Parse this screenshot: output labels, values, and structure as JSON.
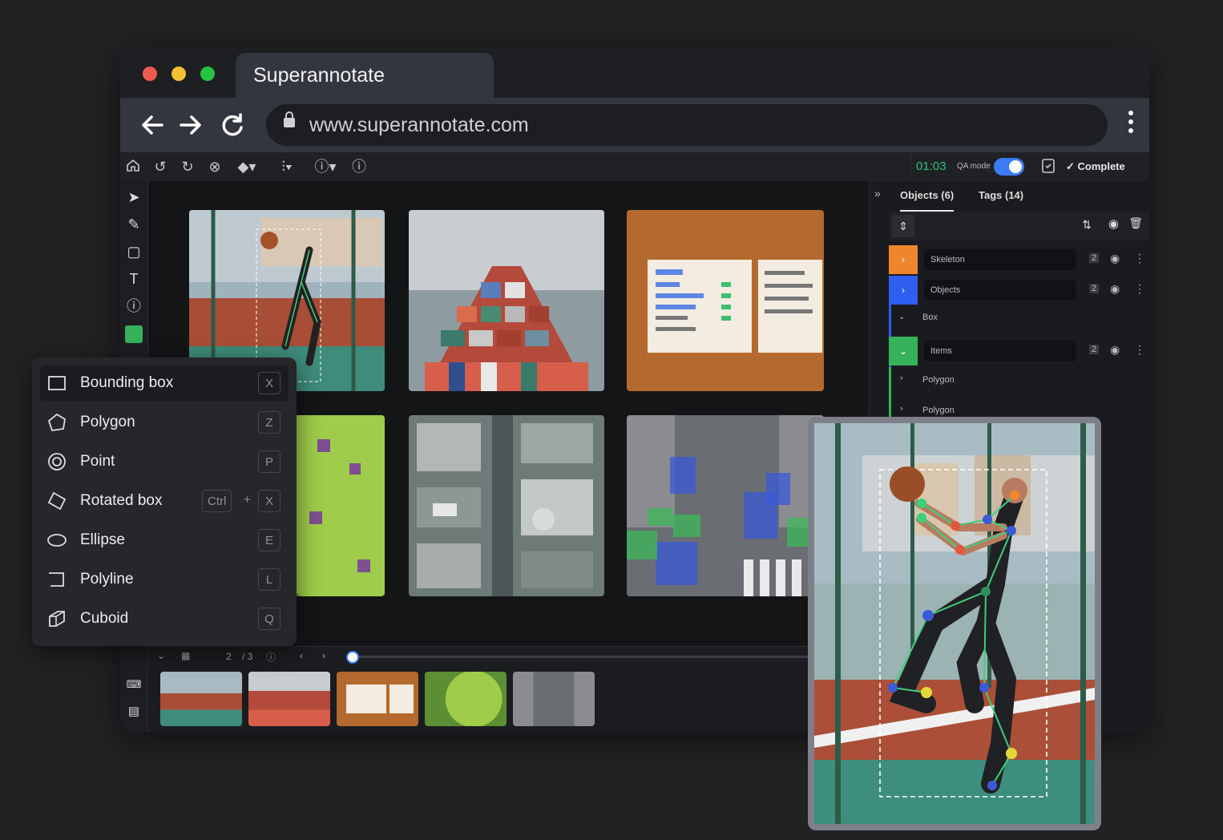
{
  "browser": {
    "tab_title": "Superannotate",
    "url": "www.superannotate.com",
    "traffic_colors": [
      "#ef5a4f",
      "#f4bf32",
      "#27c23f"
    ]
  },
  "toolbar": {
    "timer": "01:03",
    "qa_label": "QA mode",
    "complete_label": "Complete",
    "qa_enabled": true
  },
  "right_panel": {
    "tabs": [
      "Objects (6)",
      "Tags (14)"
    ],
    "groups": [
      {
        "name": "Skeleton",
        "count": "2",
        "color": "#f0862b"
      },
      {
        "name": "Objects",
        "count": "2",
        "color": "#2f5ff0"
      },
      {
        "name": "Items",
        "count": "2",
        "color": "#36b25b"
      }
    ],
    "subitems": [
      "Box",
      "Polygon",
      "Polygon"
    ]
  },
  "status": {
    "page_value": "2",
    "page_total": "/ 3"
  },
  "tool_menu": {
    "items": [
      {
        "label": "Bounding box",
        "icon": "bounding-box-icon",
        "keys": [
          "X"
        ]
      },
      {
        "label": "Polygon",
        "icon": "polygon-icon",
        "keys": [
          "Z"
        ]
      },
      {
        "label": "Point",
        "icon": "point-icon",
        "keys": [
          "P"
        ]
      },
      {
        "label": "Rotated box",
        "icon": "rotated-box-icon",
        "keys": [
          "Ctrl",
          "X"
        ]
      },
      {
        "label": "Ellipse",
        "icon": "ellipse-icon",
        "keys": [
          "E"
        ]
      },
      {
        "label": "Polyline",
        "icon": "polyline-icon",
        "keys": [
          "L"
        ]
      },
      {
        "label": "Cuboid",
        "icon": "cuboid-icon",
        "keys": [
          "Q"
        ]
      }
    ],
    "selected": "Bounding box"
  },
  "thumbnails": [
    "basketball",
    "cargo-ship",
    "menu-board",
    "leaf",
    "street-traffic"
  ]
}
